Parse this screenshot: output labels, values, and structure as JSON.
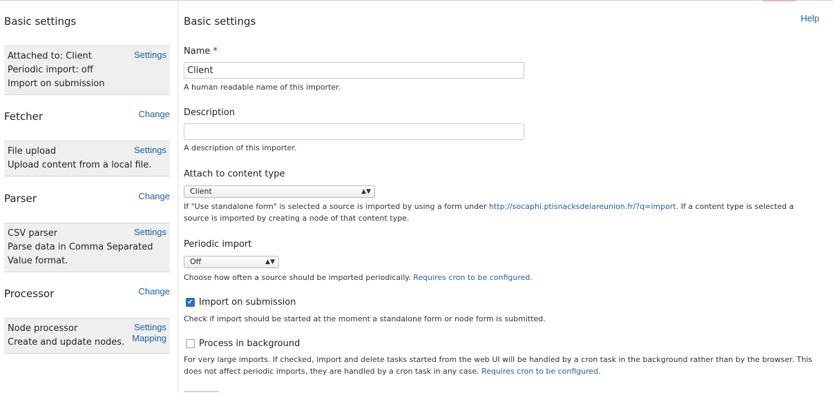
{
  "sidebar": {
    "basic_settings": {
      "title": "Basic settings",
      "lines": [
        "Attached to: Client",
        "Periodic import: off",
        "Import on submission"
      ],
      "settings_link": "Settings"
    },
    "fetcher": {
      "title": "Fetcher",
      "change_link": "Change",
      "lines": [
        "File upload",
        "Upload content from a local file."
      ],
      "settings_link": "Settings"
    },
    "parser": {
      "title": "Parser",
      "change_link": "Change",
      "lines": [
        "CSV parser",
        "Parse data in Comma Separated",
        "Value format."
      ],
      "settings_link": "Settings"
    },
    "processor": {
      "title": "Processor",
      "change_link": "Change",
      "lines": [
        "Node processor",
        "Create and update nodes."
      ],
      "settings_link": "Settings",
      "mapping_link": "Mapping"
    }
  },
  "main": {
    "title": "Basic settings",
    "help_link": "Help",
    "name": {
      "label": "Name",
      "required_marker": "*",
      "value": "Client",
      "description": "A human readable name of this importer."
    },
    "description_field": {
      "label": "Description",
      "value": "",
      "description": "A description of this importer."
    },
    "attach": {
      "label": "Attach to content type",
      "selected": "Client",
      "desc_before": "If \"Use standalone form\" is selected a source is imported by using a form under ",
      "desc_link": "http://socaphi.ptisnacksdelareunion.fr/?q=import",
      "desc_after": ". If a content type is selected a source is imported by creating a node of that content type."
    },
    "periodic": {
      "label": "Periodic import",
      "selected": "Off",
      "desc_before": "Choose how often a source should be imported periodically. ",
      "desc_link": "Requires cron to be configured."
    },
    "import_on_submission": {
      "label": "Import on submission",
      "checked": true,
      "description": "Check if import should be started at the moment a standalone form or node form is submitted."
    },
    "process_background": {
      "label": "Process in background",
      "checked": false,
      "desc_before": "For very large imports. If checked, import and delete tasks started from the web UI will be handled by a cron task in the background rather than by the browser. This does not affect periodic imports, they are handled by a cron task in any case. ",
      "desc_link": "Requires cron to be configured."
    }
  },
  "colors": {
    "link": "#1c5fa8",
    "sidebar_box": "#efefef",
    "required": "#cc0000",
    "checkbox": "#2d6bc7"
  }
}
